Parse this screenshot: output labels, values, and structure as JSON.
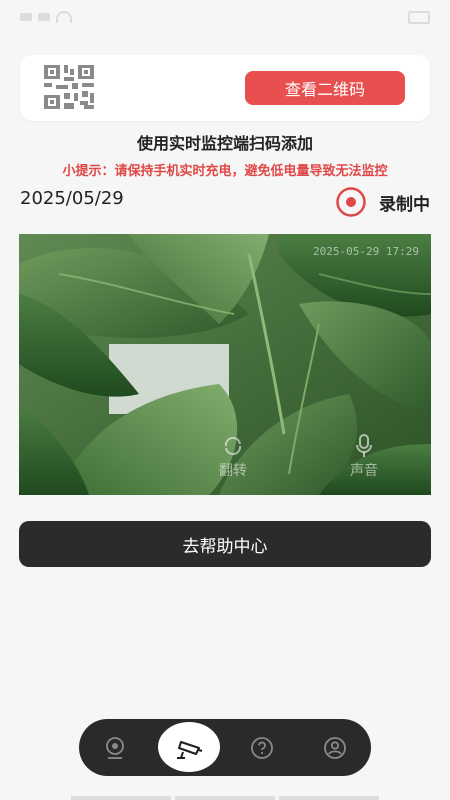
{
  "qr_card": {
    "icon": "qr-code-icon",
    "button_label": "查看二维码"
  },
  "scan_title": "使用实时监控端扫码添加",
  "tip": "小提示：请保持手机实时充电，避免低电量导致无法监控",
  "date": "2025/05/29",
  "recording": {
    "icon": "record-icon",
    "label": "录制中",
    "color": "#e04848"
  },
  "camera": {
    "timestamp": "2025-05-29 17:29",
    "controls": [
      {
        "icon": "rotate-camera-icon",
        "label": "翻转"
      },
      {
        "icon": "microphone-icon",
        "label": "声音"
      }
    ]
  },
  "help_button": {
    "label": "去帮助中心"
  },
  "tabbar": {
    "tabs": [
      {
        "icon": "webcam-icon",
        "active": false
      },
      {
        "icon": "cctv-camera-icon",
        "active": true
      },
      {
        "icon": "help-icon",
        "active": false
      },
      {
        "icon": "profile-icon",
        "active": false
      }
    ]
  },
  "colors": {
    "accent_red": "#e85050",
    "dark": "#2b2b2b",
    "background": "#f6f6f6"
  }
}
